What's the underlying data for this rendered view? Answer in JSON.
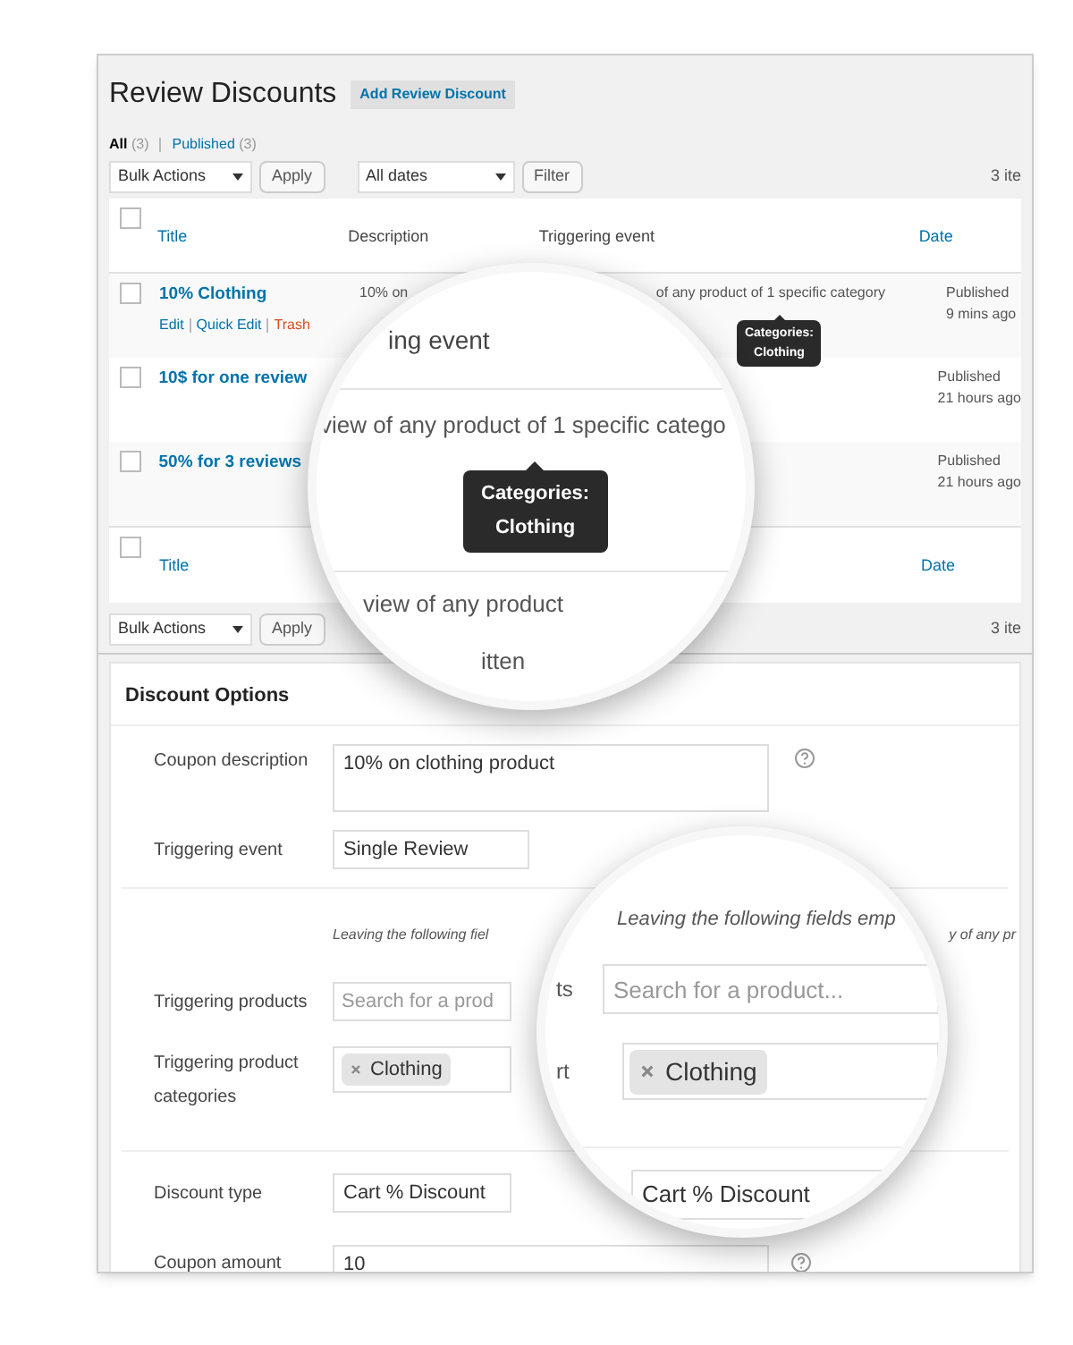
{
  "list_screen": {
    "title": "Review Discounts",
    "add_button": "Add Review Discount",
    "views": [
      {
        "label": "All",
        "count": "(3)",
        "selected": true
      },
      {
        "label": "Published",
        "count": "(3)",
        "selected": false
      }
    ],
    "bulk_actions": "Bulk Actions",
    "apply": "Apply",
    "date_filter": "All dates",
    "filter": "Filter",
    "items_count": "3 ite",
    "header_checked": false,
    "footer_checked": false,
    "columns": [
      {
        "label": "Title",
        "kind": "link"
      },
      {
        "label": "Description",
        "kind": "plain"
      },
      {
        "label": "Triggering event",
        "kind": "plain"
      },
      {
        "label": "Date",
        "kind": "link"
      }
    ],
    "rows": [
      {
        "title": "10% Clothing",
        "actions": [
          {
            "label": "Edit",
            "kind": "normal"
          },
          {
            "label": "Quick Edit",
            "kind": "normal"
          },
          {
            "label": "Trash",
            "kind": "danger"
          }
        ],
        "checked": false,
        "description": "10% on",
        "trigger": "of any product of 1 specific category",
        "tooltip": [
          "Categories:",
          "Clothing"
        ],
        "status": "Published",
        "time": "9 mins ago"
      },
      {
        "title": "10$ for one review",
        "checked": false,
        "status": "Published",
        "time": "21 hours ago"
      },
      {
        "title": "50% for 3 reviews",
        "checked": false,
        "status": "Published",
        "time": "21 hours ago"
      }
    ],
    "footer_columns": [
      {
        "label": "Title"
      },
      {
        "label": "Date"
      }
    ],
    "bottom_bulk_actions": "Bulk Actions",
    "bottom_apply": "Apply",
    "bottom_items_count": "3 ite"
  },
  "magnifier_top": {
    "heading": "ing event",
    "trigger": "view of any product of 1 specific catego",
    "tooltip": [
      "Categories:",
      "Clothing"
    ],
    "trigger_2": "view of any product",
    "bottom": "itten"
  },
  "options_panel": {
    "title": "Discount Options",
    "description": {
      "label": "Coupon description",
      "value": "10% on clothing product"
    },
    "event": {
      "label": "Triggering event",
      "value": "Single Review"
    },
    "note": {
      "start": "Leaving the following fiel",
      "end": "y of any pr"
    },
    "products": {
      "label": "Triggering products",
      "placeholder": "Search for a prod"
    },
    "categories": {
      "label": "Triggering product categories",
      "chips": [
        "Clothing"
      ]
    },
    "discount_type": {
      "label": "Discount type",
      "value": "Cart % Discount"
    },
    "amount": {
      "label": "Coupon amount",
      "value": "10"
    }
  },
  "magnifier_bottom": {
    "note": "Leaving the following fields emp",
    "placeholder": "Search for a product...",
    "fragment_1": "ts",
    "fragment_2": "rt",
    "chips": [
      "Clothing"
    ],
    "discount_type": "Cart % Discount"
  }
}
